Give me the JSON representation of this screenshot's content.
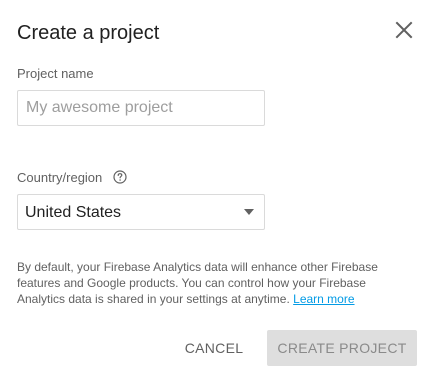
{
  "dialog": {
    "title": "Create a project",
    "close_icon": "close-icon"
  },
  "project_name": {
    "label": "Project name",
    "value": "",
    "placeholder": "My awesome project"
  },
  "country": {
    "label": "Country/region",
    "help_icon": "help-circle-icon",
    "selected": "United States",
    "arrow_icon": "dropdown-arrow-icon"
  },
  "disclaimer": {
    "text": "By default, your Firebase Analytics data will enhance other Firebase features and Google products. You can control how your Firebase Analytics data is shared in your settings at anytime.",
    "link_label": "Learn more",
    "link_color": "#039be5"
  },
  "actions": {
    "cancel_label": "CANCEL",
    "create_label": "CREATE PROJECT",
    "create_disabled": true
  }
}
